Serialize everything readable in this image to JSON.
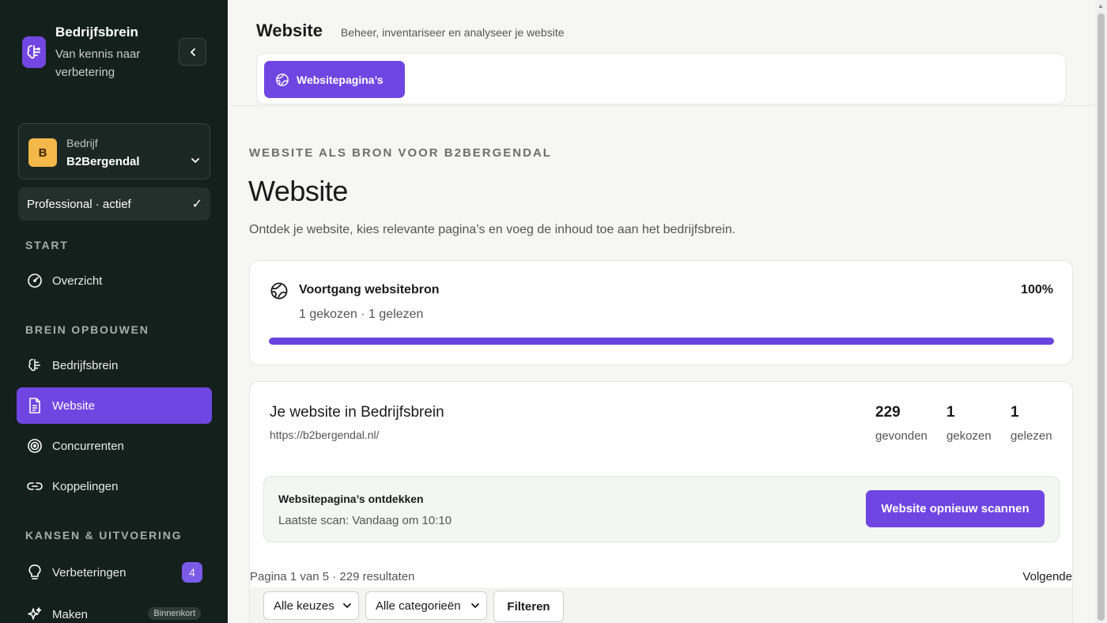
{
  "sidebar": {
    "brand_title": "Bedrijfsbrein",
    "brand_subtitle": "Van kennis naar verbetering",
    "company_label": "Bedrijf",
    "company_initial": "B",
    "company_name": "B2Bergendal",
    "plan": "Professional · actief",
    "plan_check": "✓",
    "sections": {
      "start": "START",
      "brein": "BREIN OPBOUWEN",
      "kansen": "KANSEN & UITVOERING"
    },
    "items": {
      "overzicht": "Overzicht",
      "bedrijfsbrein": "Bedrijfsbrein",
      "website": "Website",
      "concurrenten": "Concurrenten",
      "koppelingen": "Koppelingen",
      "verbeteringen": "Verbeteringen",
      "verbeteringen_count": "4",
      "maken": "Maken",
      "maken_badge": "Binnenkort"
    }
  },
  "header": {
    "title": "Website",
    "subtitle": "Beheer, inventariseer en analyseer je website",
    "tab": "Websitepagina’s"
  },
  "main": {
    "eyebrow": "WEBSITE ALS BRON VOOR B2BERGENDAL",
    "title": "Website",
    "description": "Ontdek je website, kies relevante pagina’s en voeg de inhoud toe aan het bedrijfsbrein."
  },
  "progress": {
    "title": "Voortgang websitebron",
    "percent_label": "100%",
    "percent": 100,
    "subtitle": "1 gekozen · 1 gelezen"
  },
  "site": {
    "title": "Je website in Bedrijfsbrein",
    "url": "https://b2bergendal.nl/",
    "stats": [
      {
        "value": "229",
        "label": "gevonden"
      },
      {
        "value": "1",
        "label": "gekozen"
      },
      {
        "value": "1",
        "label": "gelezen"
      }
    ],
    "discover_title": "Websitepagina’s ontdekken",
    "last_scan": "Laatste scan: Vandaag om 10:10",
    "rescan_button": "Website opnieuw scannen"
  },
  "list": {
    "pager": "Pagina 1 van 5 · 229 resultaten",
    "next": "Volgende",
    "filter_choice": "Alle keuzes",
    "filter_category": "Alle categorieën",
    "filter_button": "Filteren"
  },
  "colors": {
    "sidebar_bg": "#14201c",
    "accent": "#7046e2",
    "company_badge": "#f4b74a"
  }
}
